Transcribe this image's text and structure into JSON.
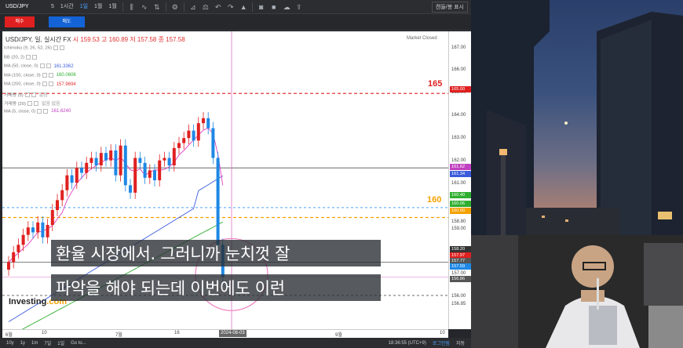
{
  "toolbar": {
    "symbol": "USD/JPY",
    "intervals": [
      "5",
      "1시간",
      "1일",
      "1월",
      "1월"
    ],
    "active_interval": "1일",
    "display_label": "캔들/봉 표시"
  },
  "trade": {
    "buy_label": "매수",
    "sell_label": "매도"
  },
  "chart": {
    "title": "USD/JPY, 일, 실시간 FX",
    "ohlc": "시 159.53  고 160.89  저 157.58  종 157.58",
    "market_status": "Market Closed",
    "indicators": [
      {
        "label": "Ichimoku (9, 26, 52, 26)",
        "value": "",
        "color": "#999999"
      },
      {
        "label": "BB (20, 2)",
        "value": "",
        "color": "#999999"
      },
      {
        "label": "MA (50, close, 0)",
        "value": "161.3362",
        "color": "#3b5bdb"
      },
      {
        "label": "MA (100, close, 0)",
        "value": "160.0606",
        "color": "#2fae2f"
      },
      {
        "label": "MA (200, close, 0)",
        "value": "157.9694",
        "color": "#e03030"
      },
      {
        "label": "거래량 (5)",
        "value": "없음",
        "color": "#999999"
      },
      {
        "label": "거래량 (20)",
        "value": "없음 없음",
        "color": "#999999"
      },
      {
        "label": "MA (5, close, 0)",
        "value": "161.6240",
        "color": "#c040c0"
      }
    ],
    "level_165": "165",
    "level_160": "160",
    "watermark_a": "Investing",
    "watermark_b": ".com",
    "y_ticks": [
      "167.00",
      "166.00",
      "165.00",
      "164.00",
      "163.00",
      "162.00",
      "161.00",
      "160.00",
      "159.00",
      "158.00",
      "157.00",
      "156.00"
    ],
    "y_tags": [
      {
        "text": "165.00",
        "color": "#e02020"
      },
      {
        "text": "161.62",
        "color": "#c040c0"
      },
      {
        "text": "161.34",
        "color": "#3b5bdb"
      },
      {
        "text": "160.40",
        "color": "#2fae2f"
      },
      {
        "text": "160.06",
        "color": "#2fae2f"
      },
      {
        "text": "160.00",
        "color": "#f4a100"
      },
      {
        "text": "158.20",
        "color": "#333333"
      },
      {
        "text": "157.97",
        "color": "#e02020"
      },
      {
        "text": "157.77",
        "color": "#555555"
      },
      {
        "text": "157.59",
        "color": "#1e88e5"
      },
      {
        "text": "156.86",
        "color": "#555555"
      }
    ],
    "y_extra": [
      "156.85",
      "158.80"
    ],
    "x_ticks": [
      "6월",
      "10",
      "7월",
      "16",
      "9월",
      "10"
    ],
    "x_current": "2024-08-03"
  },
  "bottom": {
    "ranges": [
      "10y",
      "1y",
      "1m",
      "7일",
      "1일",
      "Go to..."
    ],
    "time": "18:36:55 (UTC+9)",
    "status": "로그인됨",
    "settings": "자동"
  },
  "subtitles": {
    "line1": "환율 시장에서. 그러니까 눈치껏 잘",
    "line2": "파악을 해야 되는데 이번에도 이런"
  },
  "chart_data": {
    "type": "candlestick",
    "title": "USD/JPY, 일, 실시간 FX",
    "ylim": [
      155.5,
      167.5
    ],
    "x_range": [
      "6월",
      "8월"
    ],
    "closes": [
      158.2,
      158.6,
      158.9,
      159.3,
      159.6,
      159.4,
      159.8,
      159.2,
      159.7,
      160.3,
      160.7,
      161.1,
      161.7,
      161.4,
      162.0,
      161.8,
      162.2,
      162.4,
      162.1,
      162.6,
      162.3,
      162.7,
      161.7,
      162.9,
      161.3,
      161.0,
      162.4,
      162.2,
      161.6,
      161.9,
      161.5,
      162.3,
      162.4,
      162.1,
      162.8,
      163.0,
      163.2,
      163.5,
      163.1,
      163.8,
      164.0,
      163.6,
      162.4,
      158.9,
      157.6
    ]
  }
}
